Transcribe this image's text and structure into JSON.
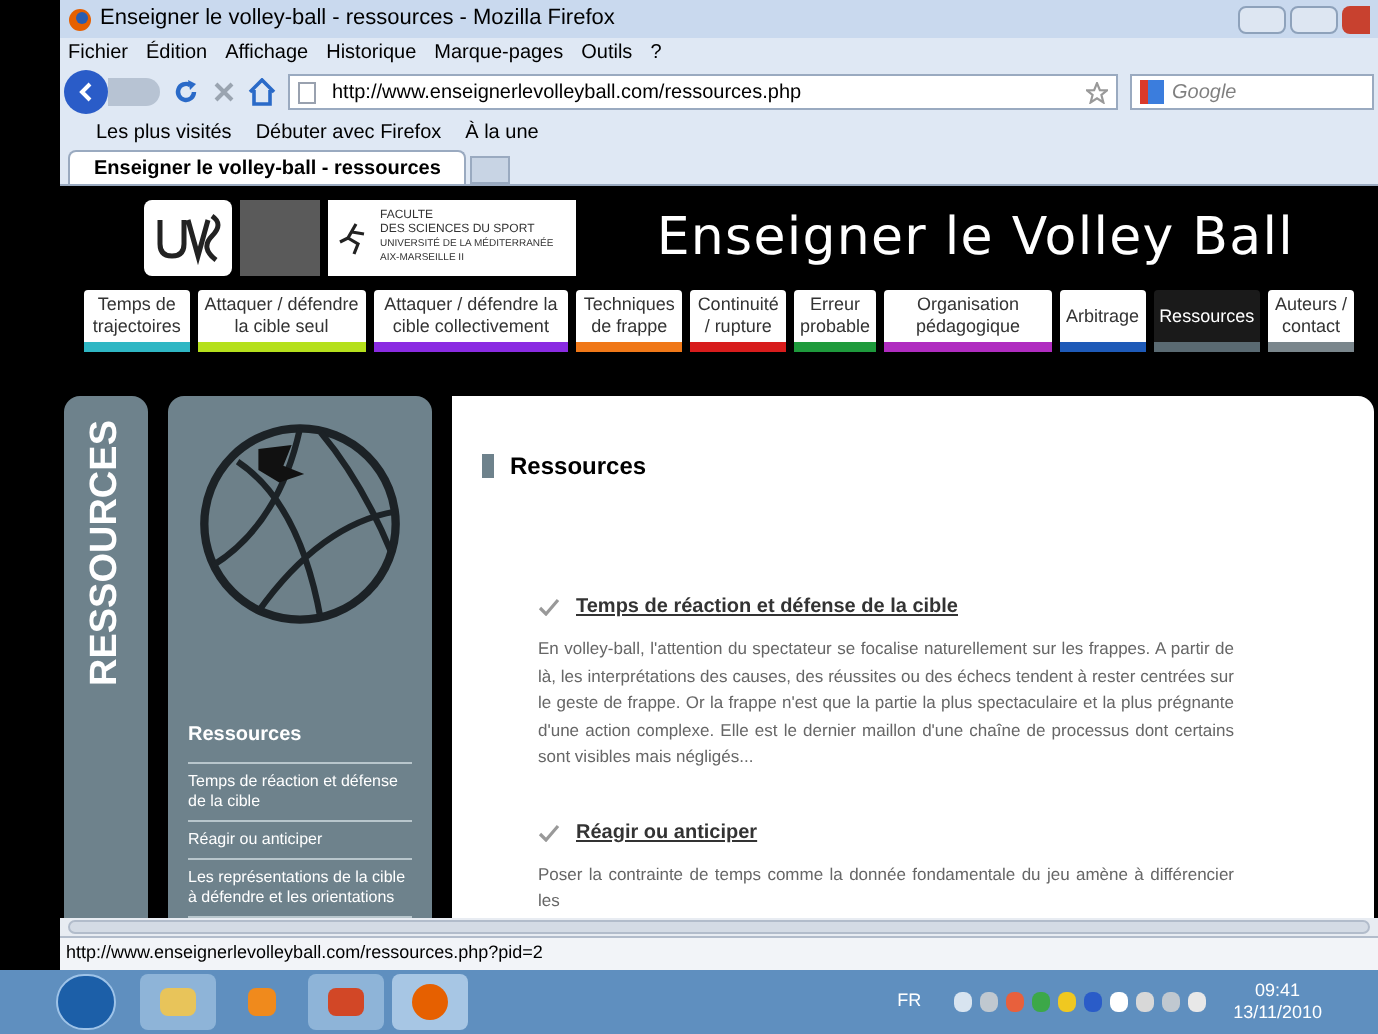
{
  "window": {
    "title": "Enseigner le volley-ball - ressources - Mozilla Firefox"
  },
  "menu": [
    "Fichier",
    "Édition",
    "Affichage",
    "Historique",
    "Marque-pages",
    "Outils",
    "?"
  ],
  "address": {
    "value": "http://www.enseignerlevolleyball.com/ressources.php"
  },
  "search": {
    "placeholder": "Google"
  },
  "bookmarks": [
    "Les plus visités",
    "Débuter avec Firefox",
    "À la une"
  ],
  "tabs": [
    {
      "label": "Enseigner le volley-ball - ressources",
      "selected": true
    }
  ],
  "page": {
    "faculty": {
      "line_1": "FACULTE",
      "line_2": "DES SCIENCES DU SPORT",
      "line_3": "UNIVERSITÉ DE LA MÉDITERRANÉE",
      "line_4": "AIX-MARSEILLE II"
    },
    "site_title": "Enseigner le Volley Ball",
    "nav": [
      {
        "label": "Temps de trajectoires",
        "color": "#2fb7c4",
        "selected": false
      },
      {
        "label": "Attaquer / défendre la cible seul",
        "color": "#b5e01c",
        "selected": false
      },
      {
        "label": "Attaquer / défendre la cible collectivement",
        "color": "#8a2be2",
        "selected": false
      },
      {
        "label": "Techniques de frappe",
        "color": "#f07818",
        "selected": false
      },
      {
        "label": "Continuité / rupture",
        "color": "#d81c1c",
        "selected": false
      },
      {
        "label": "Erreur probable",
        "color": "#1e9a3c",
        "selected": false
      },
      {
        "label": "Organisation pédagogique",
        "color": "#b02cc0",
        "selected": false
      },
      {
        "label": "Arbitrage",
        "color": "#1e5ab8",
        "selected": false
      },
      {
        "label": "Ressources",
        "color": "#5a6a72",
        "selected": true
      },
      {
        "label": "Auteurs / contact",
        "color": "#7a868c",
        "selected": false
      }
    ],
    "side_title": "RESSOURCES",
    "sidebar": {
      "title": "Ressources",
      "links": [
        "Temps de réaction et défense de la cible",
        "Réagir ou anticiper",
        "Les représentations de la cible à défendre et les orientations"
      ]
    },
    "heading": "Ressources",
    "articles": [
      {
        "title": "Temps de réaction et défense de la cible",
        "text": "En volley-ball, l'attention du spectateur se focalise naturellement sur les frappes. A partir de là, les interprétations des causes, des réussites ou des échecs tendent à rester centrées sur le geste de frappe. Or la frappe n'est que la partie la plus spectaculaire et la plus prégnante d'une action complexe. Elle est le dernier maillon d'une chaîne de processus dont certains sont visibles mais négligés..."
      },
      {
        "title": "Réagir ou anticiper",
        "text": "Poser la contrainte de temps comme la donnée fondamentale du jeu amène à différencier les"
      }
    ]
  },
  "status_bar": "http://www.enseignerlevolleyball.com/ressources.php?pid=2",
  "taskbar": {
    "language": "FR",
    "time": "09:41",
    "date": "13/11/2010"
  }
}
